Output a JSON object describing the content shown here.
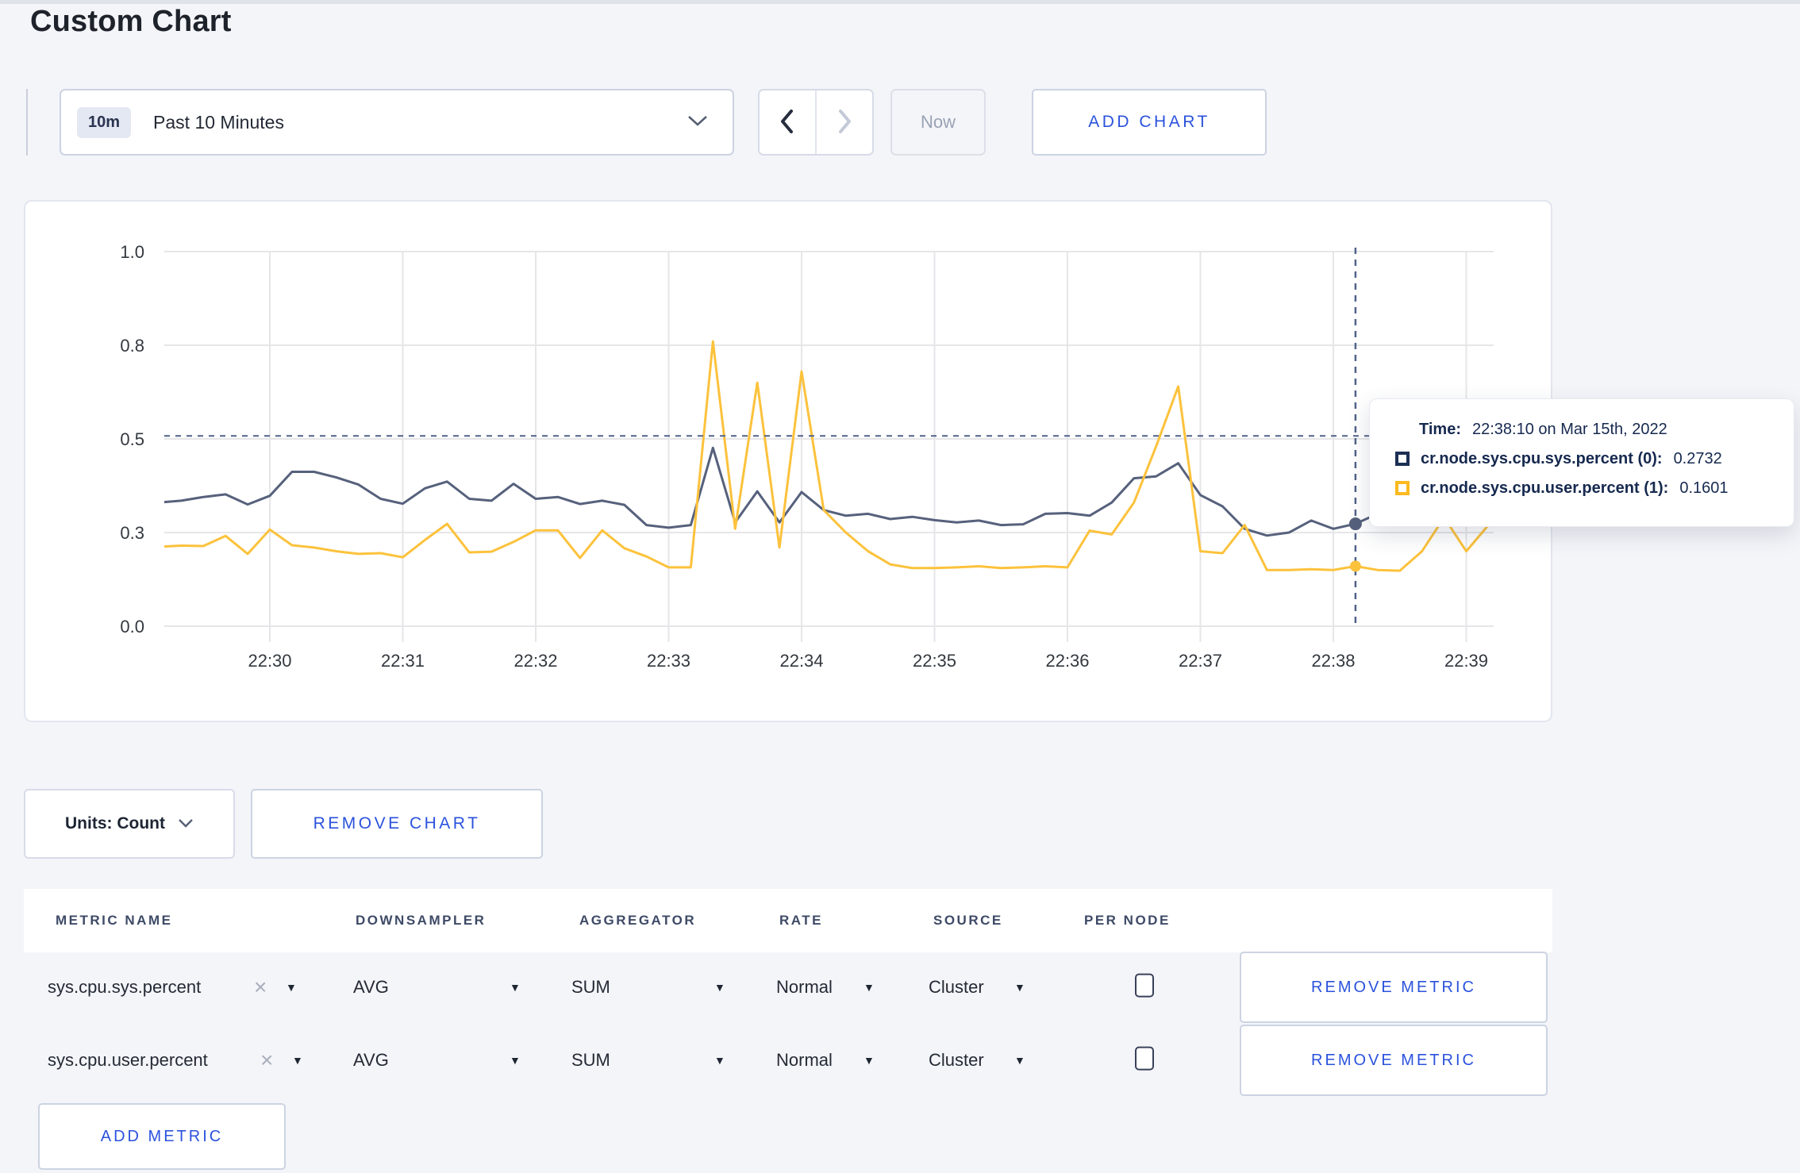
{
  "page": {
    "title": "Custom Chart"
  },
  "toolbar": {
    "time_window_badge": "10m",
    "time_window_label": "Past 10 Minutes",
    "back_icon": "chevron-left",
    "forward_icon": "chevron-right",
    "now_label": "Now",
    "add_chart_label": "ADD CHART"
  },
  "chart_data": {
    "type": "line",
    "title": "",
    "xlabel": "",
    "ylabel": "",
    "ylim": [
      0,
      1
    ],
    "grid": true,
    "legend_position": "tooltip",
    "x": [
      "22:29:10",
      "22:29:20",
      "22:29:30",
      "22:29:40",
      "22:29:50",
      "22:30:00",
      "22:30:10",
      "22:30:20",
      "22:30:30",
      "22:30:40",
      "22:30:50",
      "22:31:00",
      "22:31:10",
      "22:31:20",
      "22:31:30",
      "22:31:40",
      "22:31:50",
      "22:32:00",
      "22:32:10",
      "22:32:20",
      "22:32:30",
      "22:32:40",
      "22:32:50",
      "22:33:00",
      "22:33:10",
      "22:33:20",
      "22:33:30",
      "22:33:40",
      "22:33:50",
      "22:34:00",
      "22:34:10",
      "22:34:20",
      "22:34:30",
      "22:34:40",
      "22:34:50",
      "22:35:00",
      "22:35:10",
      "22:35:20",
      "22:35:30",
      "22:35:40",
      "22:35:50",
      "22:36:00",
      "22:36:10",
      "22:36:20",
      "22:36:30",
      "22:36:40",
      "22:36:50",
      "22:37:00",
      "22:37:10",
      "22:37:20",
      "22:37:30",
      "22:37:40",
      "22:37:50",
      "22:38:00",
      "22:38:10",
      "22:38:20",
      "22:38:30",
      "22:38:40",
      "22:38:50",
      "22:39:00",
      "22:39:10"
    ],
    "series": [
      {
        "name": "cr.node.sys.cpu.sys.percent",
        "color": "#56617c",
        "values": [
          0.33,
          0.335,
          0.345,
          0.352,
          0.325,
          0.348,
          0.412,
          0.412,
          0.397,
          0.378,
          0.34,
          0.327,
          0.368,
          0.386,
          0.34,
          0.335,
          0.38,
          0.34,
          0.345,
          0.326,
          0.335,
          0.324,
          0.27,
          0.263,
          0.27,
          0.476,
          0.277,
          0.36,
          0.277,
          0.358,
          0.31,
          0.295,
          0.3,
          0.286,
          0.292,
          0.283,
          0.277,
          0.282,
          0.27,
          0.272,
          0.3,
          0.302,
          0.295,
          0.33,
          0.395,
          0.4,
          0.435,
          0.35,
          0.32,
          0.26,
          0.242,
          0.25,
          0.282,
          0.26,
          0.2732,
          0.3,
          0.31,
          0.315,
          0.31,
          0.305,
          0.31
        ]
      },
      {
        "name": "cr.node.sys.cpu.user.percent",
        "color": "#fcc23c",
        "values": [
          0.212,
          0.215,
          0.214,
          0.241,
          0.193,
          0.258,
          0.216,
          0.21,
          0.2,
          0.193,
          0.195,
          0.184,
          0.23,
          0.273,
          0.197,
          0.199,
          0.225,
          0.256,
          0.256,
          0.182,
          0.256,
          0.208,
          0.186,
          0.157,
          0.157,
          0.76,
          0.26,
          0.65,
          0.21,
          0.68,
          0.31,
          0.25,
          0.2,
          0.165,
          0.155,
          0.155,
          0.157,
          0.16,
          0.155,
          0.157,
          0.16,
          0.157,
          0.255,
          0.245,
          0.33,
          0.48,
          0.64,
          0.2,
          0.195,
          0.27,
          0.15,
          0.15,
          0.152,
          0.15,
          0.1601,
          0.15,
          0.148,
          0.2,
          0.29,
          0.2,
          0.27
        ]
      }
    ],
    "yticks": [
      {
        "value": 0.0,
        "label": "0.0"
      },
      {
        "value": 0.25,
        "label": "0.3"
      },
      {
        "value": 0.5,
        "label": "0.5"
      },
      {
        "value": 0.75,
        "label": "0.8"
      },
      {
        "value": 1.0,
        "label": "1.0"
      }
    ],
    "xticks": [
      "22:30",
      "22:31",
      "22:32",
      "22:33",
      "22:34",
      "22:35",
      "22:36",
      "22:37",
      "22:38",
      "22:39"
    ],
    "crosshair": {
      "time": "22:38:10",
      "hline_value": 0.508
    },
    "highlight_points": [
      {
        "series": 0,
        "value": 0.2732
      },
      {
        "series": 1,
        "value": 0.1601
      }
    ]
  },
  "tooltip": {
    "time_label": "Time:",
    "time_value": "22:38:10 on Mar 15th, 2022",
    "rows": [
      {
        "label": "cr.node.sys.cpu.sys.percent (0):",
        "value": "0.2732",
        "swatch_color": "#1c2f55"
      },
      {
        "label": "cr.node.sys.cpu.user.percent (1):",
        "value": "0.1601",
        "swatch_color": "#fcba1f"
      }
    ]
  },
  "chart_controls": {
    "units_label": "Units: Count",
    "remove_chart_label": "REMOVE CHART"
  },
  "metrics_table": {
    "headers": [
      "METRIC NAME",
      "DOWNSAMPLER",
      "AGGREGATOR",
      "RATE",
      "SOURCE",
      "PER NODE"
    ],
    "rows": [
      {
        "metric": "sys.cpu.sys.percent",
        "downsampler": "AVG",
        "aggregator": "SUM",
        "rate": "Normal",
        "source": "Cluster",
        "per_node_checked": false,
        "remove_label": "REMOVE METRIC"
      },
      {
        "metric": "sys.cpu.user.percent",
        "downsampler": "AVG",
        "aggregator": "SUM",
        "rate": "Normal",
        "source": "Cluster",
        "per_node_checked": false,
        "remove_label": "REMOVE METRIC"
      }
    ],
    "add_metric_label": "ADD METRIC"
  },
  "colors": {
    "accent_blue": "#2b52dd",
    "line_sys": "#56617c",
    "line_user": "#fcc23c",
    "crosshair": "#51628a",
    "grid": "#e6e6e9",
    "page_background": "#f4f5f9"
  }
}
